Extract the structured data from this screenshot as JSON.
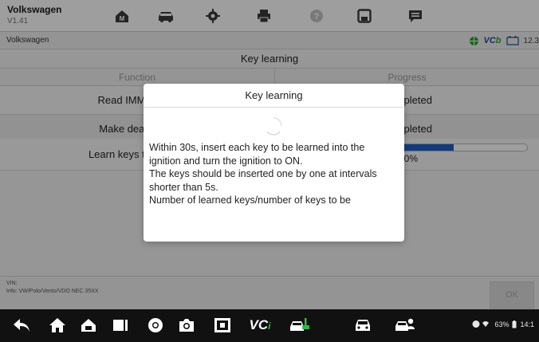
{
  "app": {
    "name": "Volkswagen",
    "version": "V1.41"
  },
  "toolbar": {
    "icons": [
      "home-icon",
      "vehicle-swap-icon",
      "settings-icon",
      "print-icon",
      "help-icon",
      "save-icon",
      "data-logging-icon"
    ]
  },
  "status": {
    "vehicle": "Volkswagen",
    "vcb_main": "VC",
    "vcb_tail": "b",
    "clock": "12.3"
  },
  "page": {
    "title": "Key learning"
  },
  "table": {
    "headers": [
      "Function",
      "Progress"
    ],
    "rows": [
      {
        "function": "Read IMMO data",
        "progress": "Completed"
      },
      {
        "function": "Make dealer key",
        "progress": "Completed"
      },
      {
        "function": "Learn keys to vehicle",
        "progress": "70%",
        "progress_value": 0.7
      }
    ]
  },
  "footer": {
    "vin_label": "VIN:",
    "info": "Info: VW/Polo/Vento/VDO NEC 35XX",
    "ok_label": "OK"
  },
  "dialog": {
    "title": "Key learning",
    "message": [
      "Within 30s, insert each key to be learned into the",
      "ignition and turn the ignition to ON.",
      "The keys should be inserted one by one at intervals",
      "shorter than 5s.",
      "Number of learned keys/number of keys to be"
    ]
  },
  "navbar": {
    "vci_main": "VC",
    "vci_tail": "i",
    "system_status": "63%",
    "clock": "14:1"
  },
  "colors": {
    "accent": "#1f5fc4",
    "progress_bar": "#1f5fc4",
    "vc_green": "#35b84a"
  }
}
